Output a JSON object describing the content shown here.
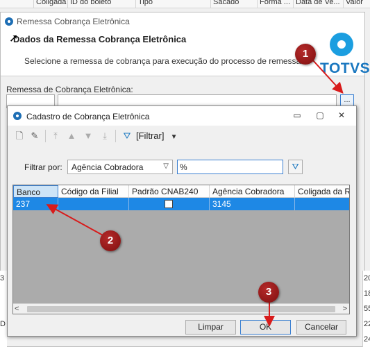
{
  "background": {
    "columns": [
      "Coligada",
      "ID do boleto",
      "Tipo",
      "Sacado",
      "Forma ...",
      "Data de Ve...",
      "Valor"
    ],
    "right_values": [
      "20",
      "18",
      "55",
      "22",
      "24"
    ],
    "left_values": [
      "3",
      "",
      "",
      "D",
      ""
    ]
  },
  "outer": {
    "title": "Remessa Cobrança Eletrônica",
    "heading": "Dados da Remessa Cobrança Eletrônica",
    "subtitle": "Selecione a remessa de cobrança para execução do processo de remessa.",
    "logo_text": "TOTVS",
    "field_label": "Remessa de Cobrança Eletrônica:",
    "code_value": "",
    "desc_value": "",
    "lookup_button": "..."
  },
  "inner": {
    "title": "Cadastro de Cobrança Eletrônica",
    "window_buttons": {
      "minimize": "▭",
      "restore": "▢",
      "close": "✕"
    },
    "toolbar": {
      "filter_label": "[Filtrar]"
    },
    "filter_by_label": "Filtrar por:",
    "filter_field": "Agência Cobradora",
    "filter_value": "%",
    "grid": {
      "columns": [
        "Banco",
        "Código da Filial",
        "Padrão CNAB240",
        "Agência Cobradora",
        "Coligada da Re"
      ],
      "rows": [
        {
          "banco": "237",
          "codigo_filial": "",
          "padrao_cnab240": false,
          "agencia": "3145",
          "coligada": ""
        }
      ]
    },
    "buttons": {
      "limpar": "Limpar",
      "ok": "OK",
      "cancelar": "Cancelar"
    }
  },
  "annotations": {
    "badge1": "1",
    "badge2": "2",
    "badge3": "3",
    "color": "#d81b1b"
  },
  "colors": {
    "selection": "#1e88e5",
    "brand": "#1b78c0",
    "badge": "#8b1414"
  }
}
